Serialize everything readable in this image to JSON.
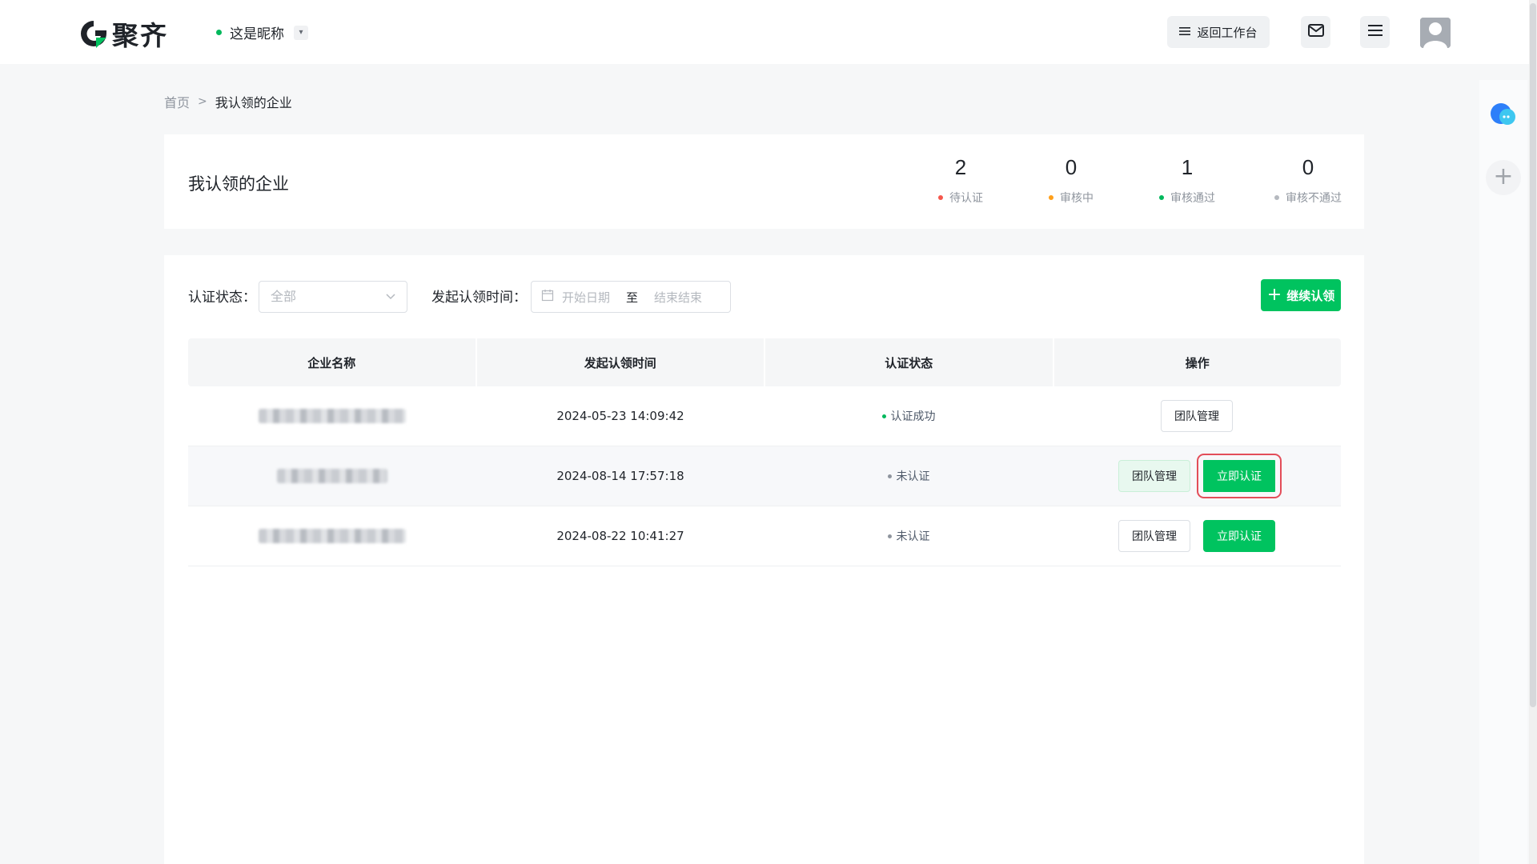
{
  "header": {
    "logo_text": "聚齐",
    "nickname": "这是昵称",
    "caret": "▾",
    "back_label": "返回工作台"
  },
  "breadcrumb": {
    "home": "首页",
    "separator": ">",
    "current": "我认领的企业"
  },
  "summary": {
    "title": "我认领的企业",
    "stats": [
      {
        "value": "2",
        "label": "待认证",
        "color": "#f5574c"
      },
      {
        "value": "0",
        "label": "审核中",
        "color": "#ff9f1a"
      },
      {
        "value": "1",
        "label": "审核通过",
        "color": "#00b85c"
      },
      {
        "value": "0",
        "label": "审核不通过",
        "color": "#b5b9bf"
      }
    ]
  },
  "filters": {
    "status_label": "认证状态：",
    "status_value": "全部",
    "time_label": "发起认领时间：",
    "start_placeholder": "开始日期",
    "to": "至",
    "end_placeholder": "结束结束",
    "add_button": "继续认领"
  },
  "table": {
    "headers": [
      "企业名称",
      "发起认领时间",
      "认证状态",
      "操作"
    ],
    "rows": [
      {
        "time": "2024-05-23 14:09:42",
        "status": "认证成功",
        "status_color": "#00b85c",
        "team": "团队管理"
      },
      {
        "time": "2024-08-14 17:57:18",
        "status": "未认证",
        "status_color": "#8f959e",
        "team": "团队管理",
        "certify": "立即认证"
      },
      {
        "time": "2024-08-22 10:41:27",
        "status": "未认证",
        "status_color": "#8f959e",
        "team": "团队管理",
        "certify": "立即认证"
      }
    ]
  },
  "colors": {
    "accent": "#00c35f",
    "highlight": "#e34d59"
  }
}
